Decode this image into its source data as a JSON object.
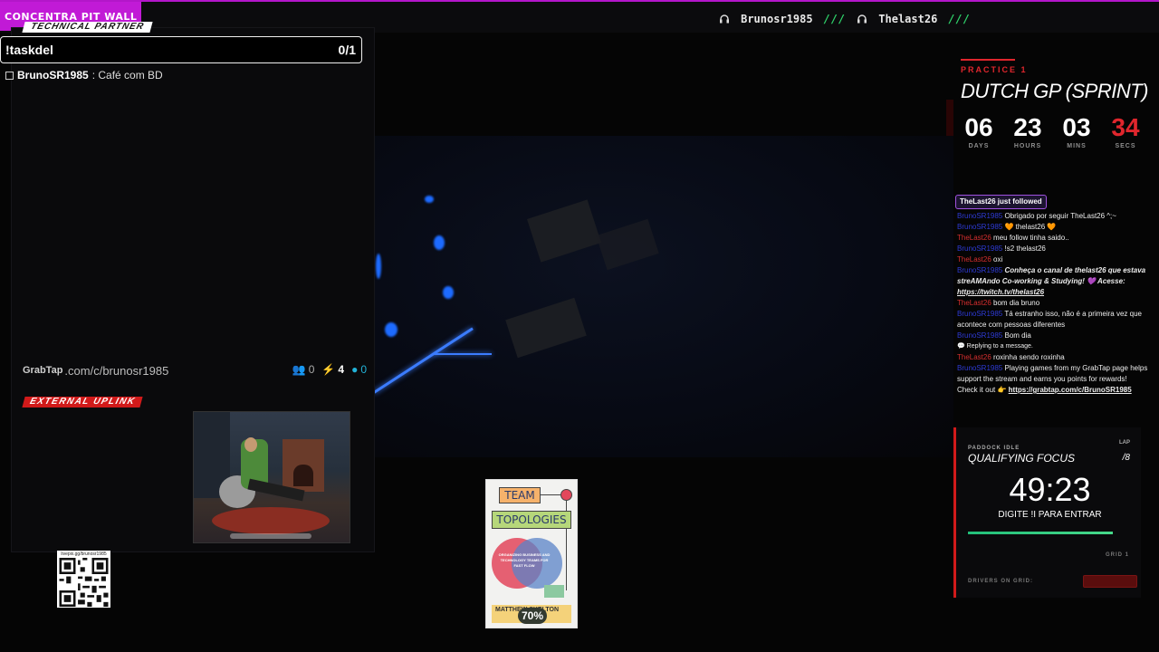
{
  "top": {
    "brand": "CONCENTRA PIT WALL",
    "credits": [
      {
        "name": "Brunosr1985",
        "sep": "///"
      },
      {
        "name": "Thelast26",
        "sep": "///"
      }
    ]
  },
  "tasks": {
    "section_label": "TECHNICAL PARTNER",
    "command": "!taskdel",
    "count": "0/1",
    "items": [
      {
        "user": "BrunoSR1985",
        "text": ": Café com BD"
      }
    ]
  },
  "grabtap": {
    "logo": "GrabTap",
    "url": ".com/c/brunosr1985",
    "viewers": "0",
    "bolts": "4",
    "points": "0"
  },
  "uplink": {
    "label": "EXTERNAL UPLINK"
  },
  "qr": {
    "url": "livepix.gg/brunosr1985"
  },
  "book": {
    "title_1": "TEAM",
    "title_2": "TOPOLOGIES",
    "subtitle": "ORGANIZING BUSINESS AND TECHNOLOGY TEAMS FOR FAST FLOW",
    "authors": "MATTHEW SKELTON",
    "progress": "70%"
  },
  "countdown": {
    "session": "PRACTICE 1",
    "event": "DUTCH GP (SPRINT)",
    "days": "06",
    "days_lbl": "DAYS",
    "hours": "23",
    "hours_lbl": "HOURS",
    "mins": "03",
    "mins_lbl": "MINS",
    "secs": "34",
    "secs_lbl": "SECS"
  },
  "chat": {
    "follow": "TheLast26 just followed",
    "lines": [
      {
        "user": "BrunoSR1985",
        "text": " Obrigado por seguir TheLast26 ^;~"
      },
      {
        "user": "BrunoSR1985",
        "text": " 🧡 thelast26 🧡"
      },
      {
        "user": "TheLast26",
        "text": " meu follow tinha saido.."
      },
      {
        "user": "BrunoSR1985",
        "text": " !s2 thelast26"
      },
      {
        "user": "TheLast26",
        "text": " oxi"
      },
      {
        "user": "BrunoSR1985",
        "text": " Conheça o canal de thelast26 que estava streAMAndo Co-working & Studying! 💜 Acesse: ",
        "link": "https://twitch.tv/thelast26"
      },
      {
        "user": "TheLast26",
        "text": " bom dia bruno"
      },
      {
        "user": "BrunoSR1985",
        "text": " Tá estranho isso, não é a primeira vez que acontece com pessoas diferentes"
      },
      {
        "user": "BrunoSR1985",
        "text": " Bom dia"
      },
      {
        "user": "",
        "text": "💬 Replying to a message."
      },
      {
        "user": "TheLast26",
        "text": " roxinha sendo roxinha"
      },
      {
        "user": "BrunoSR1985",
        "text": " Playing games from my GrabTap page helps support the stream and earns you points for rewards! Check it out 👉 ",
        "link": "https://grabtap.com/c/BrunoSR1985"
      }
    ]
  },
  "qualifying": {
    "paddock": "PADDOCK IDLE",
    "lap_label": "LAP",
    "title": "QUALIFYING FOCUS",
    "lap": "/8",
    "timer": "49:23",
    "enter": "DIGITE !I PARA ENTRAR",
    "progress": 0.94,
    "grid": "GRID 1",
    "drivers": "DRIVERS ON GRID:"
  }
}
